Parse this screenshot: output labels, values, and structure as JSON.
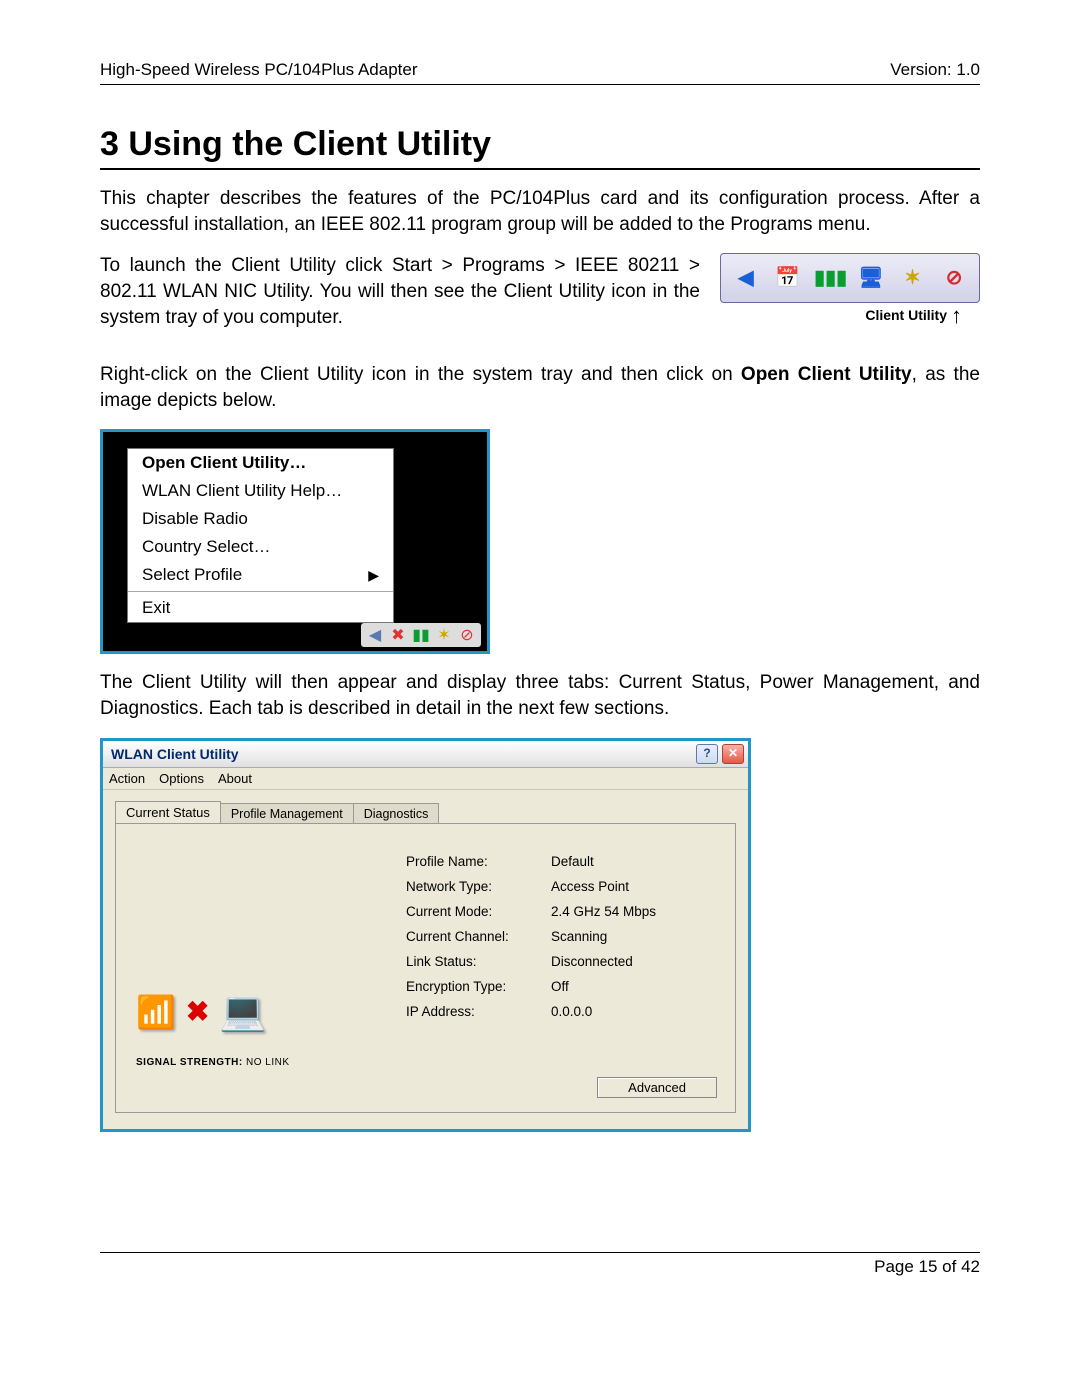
{
  "header": {
    "left": "High-Speed Wireless PC/104Plus Adapter",
    "right": "Version: 1.0"
  },
  "chapter_title": "3  Using the Client Utility",
  "para1": "This chapter describes the features of the PC/104Plus card and its configuration process.  After a successful installation, an IEEE 802.11 program group will be added to the Programs menu.",
  "para2": "To launch the Client Utility click Start > Programs > IEEE 80211 > 802.11 WLAN NIC Utility.  You will then see the Client Utility icon in the system tray of you computer.",
  "tray_caption": "Client Utility",
  "para3a": "Right-click on the Client Utility icon in the system tray and then click on ",
  "para3b_bold": "Open Client Utility",
  "para3c": ", as the image depicts below.",
  "context_menu": {
    "items": [
      {
        "label": "Open Client Utility…",
        "bold": true
      },
      {
        "label": "WLAN Client Utility Help…"
      },
      {
        "label": "Disable Radio"
      },
      {
        "label": "Country Select…"
      },
      {
        "label": "Select Profile",
        "submenu": true
      }
    ],
    "after_sep": {
      "label": "Exit"
    }
  },
  "para4": "The Client Utility will then appear and display three tabs: Current Status, Power Management, and Diagnostics. Each tab is described in detail in the next few sections.",
  "dialog": {
    "title": "WLAN Client Utility",
    "menu": [
      "Action",
      "Options",
      "About"
    ],
    "tabs": [
      "Current Status",
      "Profile Management",
      "Diagnostics"
    ],
    "active_tab": 0,
    "signal_label": "SIGNAL STRENGTH:",
    "signal_value": "NO LINK",
    "fields": [
      {
        "label": "Profile Name:",
        "value": "Default"
      },
      {
        "label": "Network Type:",
        "value": "Access Point"
      },
      {
        "label": "Current Mode:",
        "value": "2.4 GHz 54 Mbps"
      },
      {
        "label": "Current Channel:",
        "value": "Scanning"
      },
      {
        "label": "Link Status:",
        "value": "Disconnected"
      },
      {
        "label": "Encryption Type:",
        "value": "Off"
      },
      {
        "label": "IP Address:",
        "value": "0.0.0.0"
      }
    ],
    "adv_button": "Advanced"
  },
  "footer": "Page 15 of 42"
}
